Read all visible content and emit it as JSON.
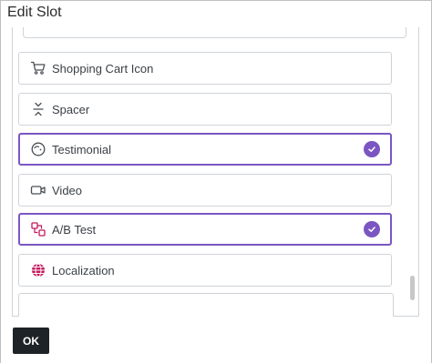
{
  "dialog": {
    "title": "Edit Slot"
  },
  "slots": [
    {
      "label": "Shopping Cart Icon",
      "icon": "shopping-cart-icon",
      "selected": false
    },
    {
      "label": "Spacer",
      "icon": "spacer-icon",
      "selected": false
    },
    {
      "label": "Testimonial",
      "icon": "testimonial-icon",
      "selected": true
    },
    {
      "label": "Video",
      "icon": "video-icon",
      "selected": false
    },
    {
      "label": "A/B Test",
      "icon": "ab-test-icon",
      "selected": true
    },
    {
      "label": "Localization",
      "icon": "globe-icon",
      "selected": false
    }
  ],
  "footer": {
    "ok_label": "OK"
  },
  "colors": {
    "accent": "#7b56c2",
    "globe": "#c2185b",
    "ok_bg": "#1d2327"
  }
}
